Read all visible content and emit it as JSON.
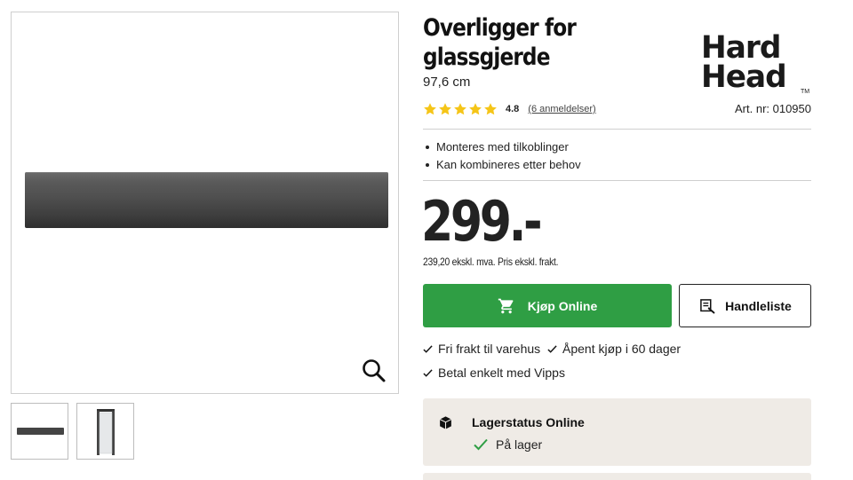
{
  "product": {
    "title_line1": "Overligger for",
    "title_line2": "glassgjerde",
    "variant": "97,6 cm",
    "brand_line1": "Hard",
    "brand_line2": "Head",
    "brand_tm": "TM",
    "rating": {
      "stars": 5,
      "value": "4.8",
      "reviews_label": "(6 anmeldelser)"
    },
    "art_nr": "Art. nr: 010950",
    "features": [
      "Monteres med tilkoblinger",
      "Kan kombineres etter behov"
    ],
    "price": "299.-",
    "price_note": "239,20 ekskl. mva. Pris ekskl. frakt."
  },
  "actions": {
    "buy_label": "Kjøp Online",
    "list_label": "Handleliste"
  },
  "perks": [
    "Fri frakt til varehus",
    "Åpent kjøp i 60 dager",
    "Betal enkelt med Vipps"
  ],
  "stock": {
    "title": "Lagerstatus Online",
    "status": "På lager"
  },
  "colors": {
    "buy_button": "#2f9e44",
    "star": "#f5c518",
    "stock_box": "#efebe6"
  },
  "icons": {
    "zoom": "magnifier-icon",
    "cart": "cart-icon",
    "list": "shopping-list-icon",
    "check": "check-icon",
    "stock": "box-icon"
  }
}
